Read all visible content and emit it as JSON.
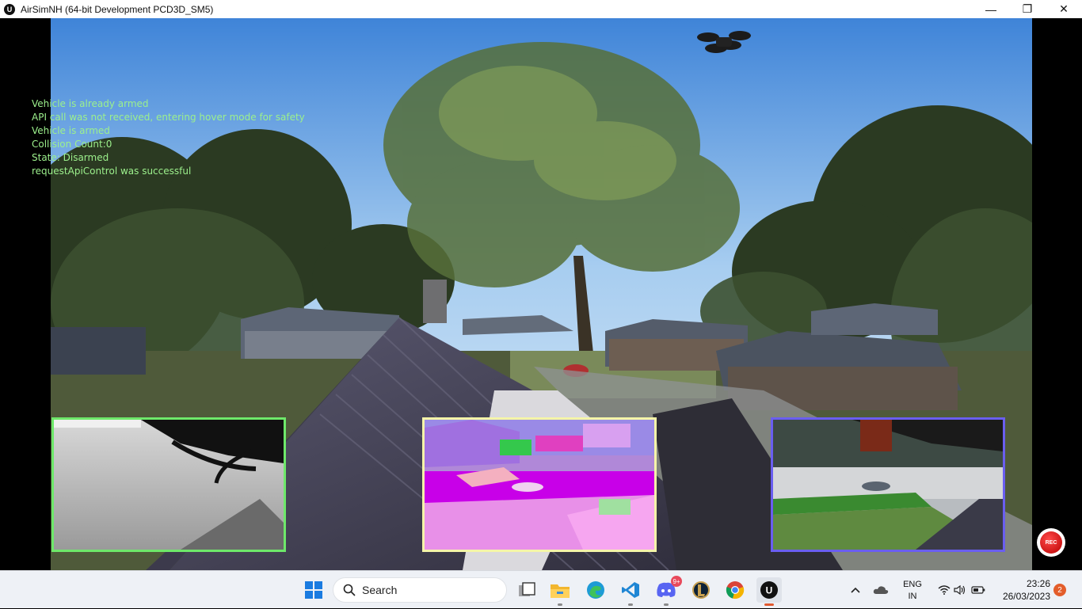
{
  "window": {
    "title": "AirSimNH (64-bit Development PCD3D_SM5)",
    "app_icon": "unreal-engine-icon",
    "minimize_glyph": "—",
    "maximize_glyph": "❐",
    "close_glyph": "✕"
  },
  "overlay_messages": [
    "Vehicle is already armed",
    "API call was not received, entering hover mode for safety",
    "Vehicle is armed",
    "Collision Count:0",
    "State: Disarmed",
    "requestApiControl was successful"
  ],
  "subviews": {
    "depth": {
      "border_color": "#6ee86a"
    },
    "segmentation": {
      "border_color": "#f5f5a8"
    },
    "scene": {
      "border_color": "#6a5ef0"
    }
  },
  "record_button": {
    "label": "REC"
  },
  "taskbar": {
    "search_label": "Search",
    "apps": [
      {
        "name": "windows-start-icon"
      },
      {
        "name": "task-view-icon"
      },
      {
        "name": "file-explorer-icon"
      },
      {
        "name": "edge-icon"
      },
      {
        "name": "vscode-icon"
      },
      {
        "name": "discord-icon",
        "badge": "9+"
      },
      {
        "name": "league-of-legends-icon"
      },
      {
        "name": "chrome-icon"
      },
      {
        "name": "unreal-engine-icon"
      }
    ]
  },
  "tray": {
    "language_line1": "ENG",
    "language_line2": "IN",
    "time": "23:26",
    "date": "26/03/2023",
    "notification_count": "2"
  }
}
